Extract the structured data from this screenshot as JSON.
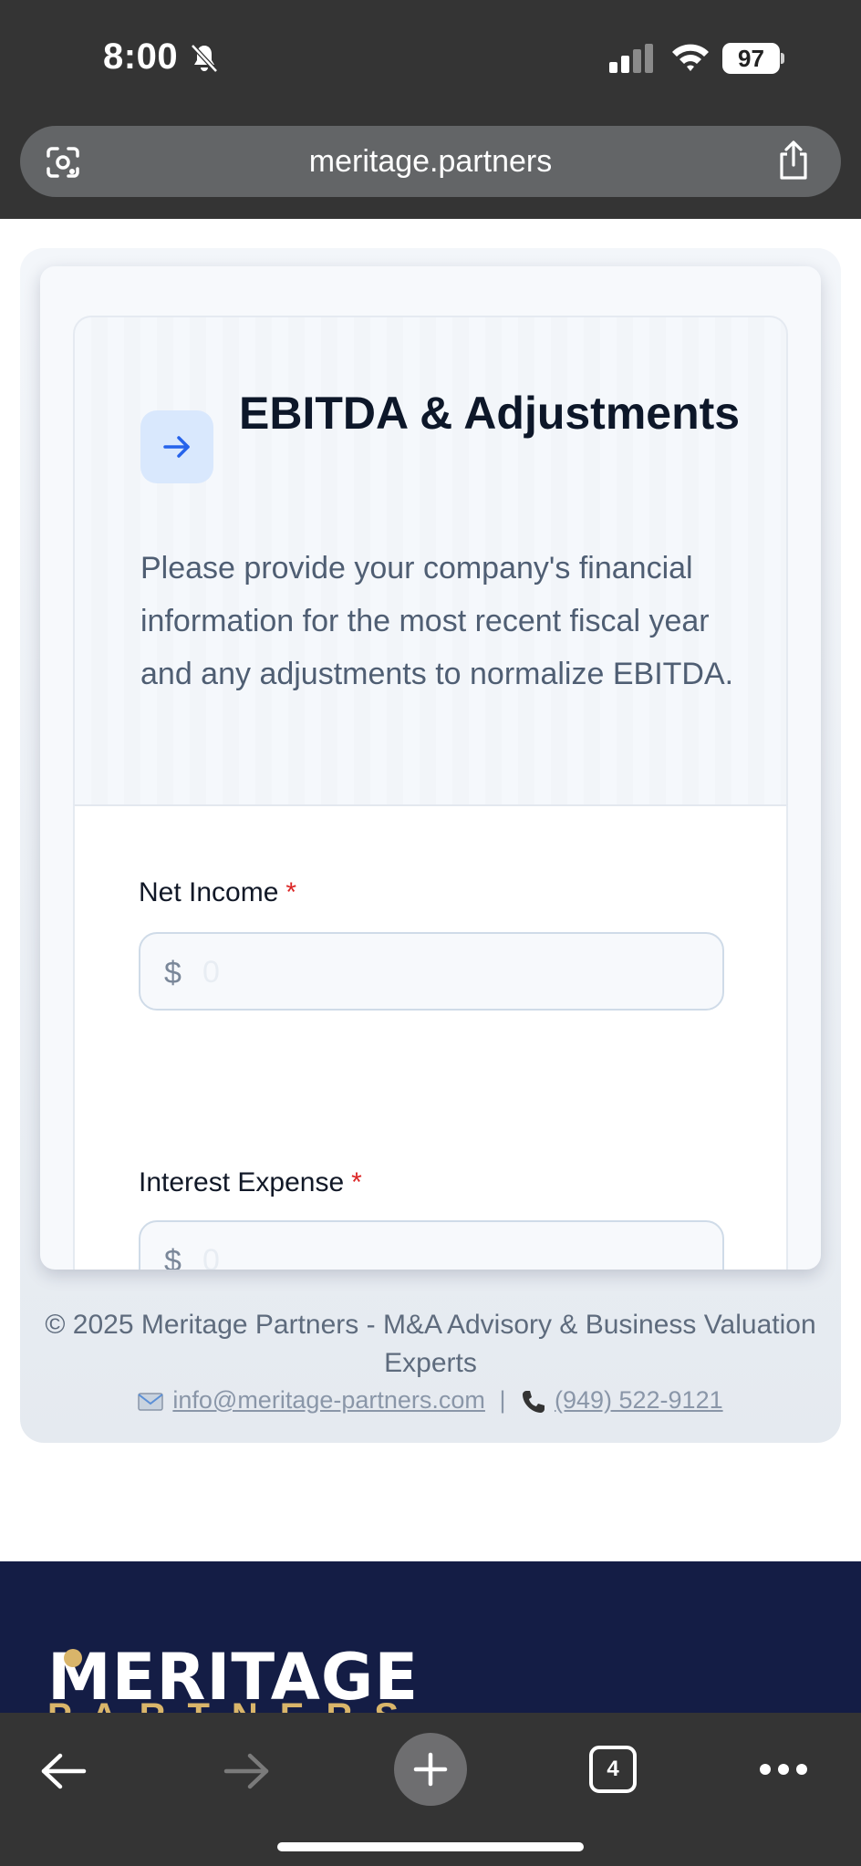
{
  "status_bar": {
    "time": "8:00",
    "battery": "97"
  },
  "browser": {
    "url": "meritage.partners",
    "tab_count": "4"
  },
  "section": {
    "title": "EBITDA & Adjustments",
    "description": "Please provide your company's financial information for the most recent fiscal year and any adjustments to normalize EBITDA."
  },
  "fields": [
    {
      "label": "Net Income",
      "required_mark": "*",
      "currency": "$",
      "placeholder": "0"
    },
    {
      "label": "Interest Expense",
      "required_mark": "*",
      "currency": "$",
      "placeholder": "0"
    }
  ],
  "footer": {
    "copyright": "© 2025 Meritage Partners - M&A Advisory & Business Valuation Experts",
    "email": "info@meritage-partners.com",
    "separator": "|",
    "phone": "(949) 522-9121"
  },
  "site_footer": {
    "logo_main": "MERITAGE",
    "logo_sub": "PARTNERS"
  },
  "colors": {
    "accent": "#2563eb",
    "required": "#dc2626",
    "navy": "#141d45",
    "gold": "#d9b56a"
  }
}
